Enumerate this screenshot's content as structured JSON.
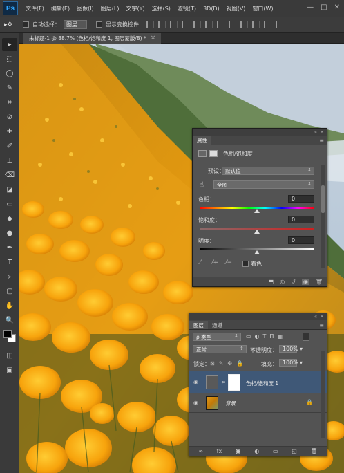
{
  "menubar": {
    "logo": "Ps",
    "items": [
      "文件(F)",
      "编辑(E)",
      "图像(I)",
      "图层(L)",
      "文字(Y)",
      "选择(S)",
      "滤镜(T)",
      "3D(D)",
      "视图(V)",
      "窗口(W)"
    ],
    "window_controls": [
      "—",
      "□",
      "✕"
    ]
  },
  "options": {
    "tool_glyph": "▸✥",
    "auto_select_label": "自动选择：",
    "auto_select_value": "图层",
    "transform_label": "显示变换控件"
  },
  "document": {
    "tab_title": "未标题-1 @ 88.7% (色相/饱和度 1, 图层蒙版/8) *",
    "close": "×"
  },
  "toolbox": {
    "tools": [
      "move-tool",
      "marquee-tool",
      "lasso-tool",
      "quick-select-tool",
      "crop-tool",
      "eyedropper-tool",
      "healing-tool",
      "brush-tool",
      "stamp-tool",
      "history-brush-tool",
      "eraser-tool",
      "gradient-tool",
      "blur-tool",
      "dodge-tool",
      "pen-tool",
      "type-tool",
      "path-select-tool",
      "shape-tool",
      "hand-tool",
      "zoom-tool"
    ],
    "glyphs": [
      "▸",
      "⬚",
      "◯",
      "✎",
      "⌗",
      "⊘",
      "✚",
      "✐",
      "⊥",
      "⌫",
      "◪",
      "▭",
      "◆",
      "●",
      "✒",
      "T",
      "▹",
      "▢",
      "✋",
      "🔍"
    ]
  },
  "properties": {
    "tabs": [
      "属性"
    ],
    "adjustment_title": "色相/饱和度",
    "preset_label": "预设：",
    "preset_value": "默认值",
    "channel_value": "全图",
    "hue_label": "色相：",
    "hue_value": "0",
    "saturation_label": "饱和度：",
    "saturation_value": "0",
    "lightness_label": "明度：",
    "lightness_value": "0",
    "colorize_label": "着色",
    "hue_slider_fraction": 0.5,
    "saturation_slider_fraction": 0.5,
    "lightness_slider_fraction": 0.5
  },
  "layers": {
    "tabs": [
      "图层",
      "通道"
    ],
    "filter_value": "ρ 类型",
    "blend_mode": "正常",
    "opacity_label": "不透明度：",
    "opacity_value": "100%",
    "lock_label": "锁定：",
    "fill_label": "填充：",
    "fill_value": "100%",
    "items": [
      {
        "name": "色相/饱和度 1",
        "selected": true
      },
      {
        "name": "背景",
        "selected": false
      }
    ],
    "footer_icons": [
      "∞",
      "fx",
      "◙",
      "◐",
      "▭",
      "◱",
      "🗑"
    ]
  },
  "colors": {
    "ps_blue": "#31a8ff",
    "selection_blue": "#3f5877",
    "poppy_orange": "#f5a10a"
  }
}
